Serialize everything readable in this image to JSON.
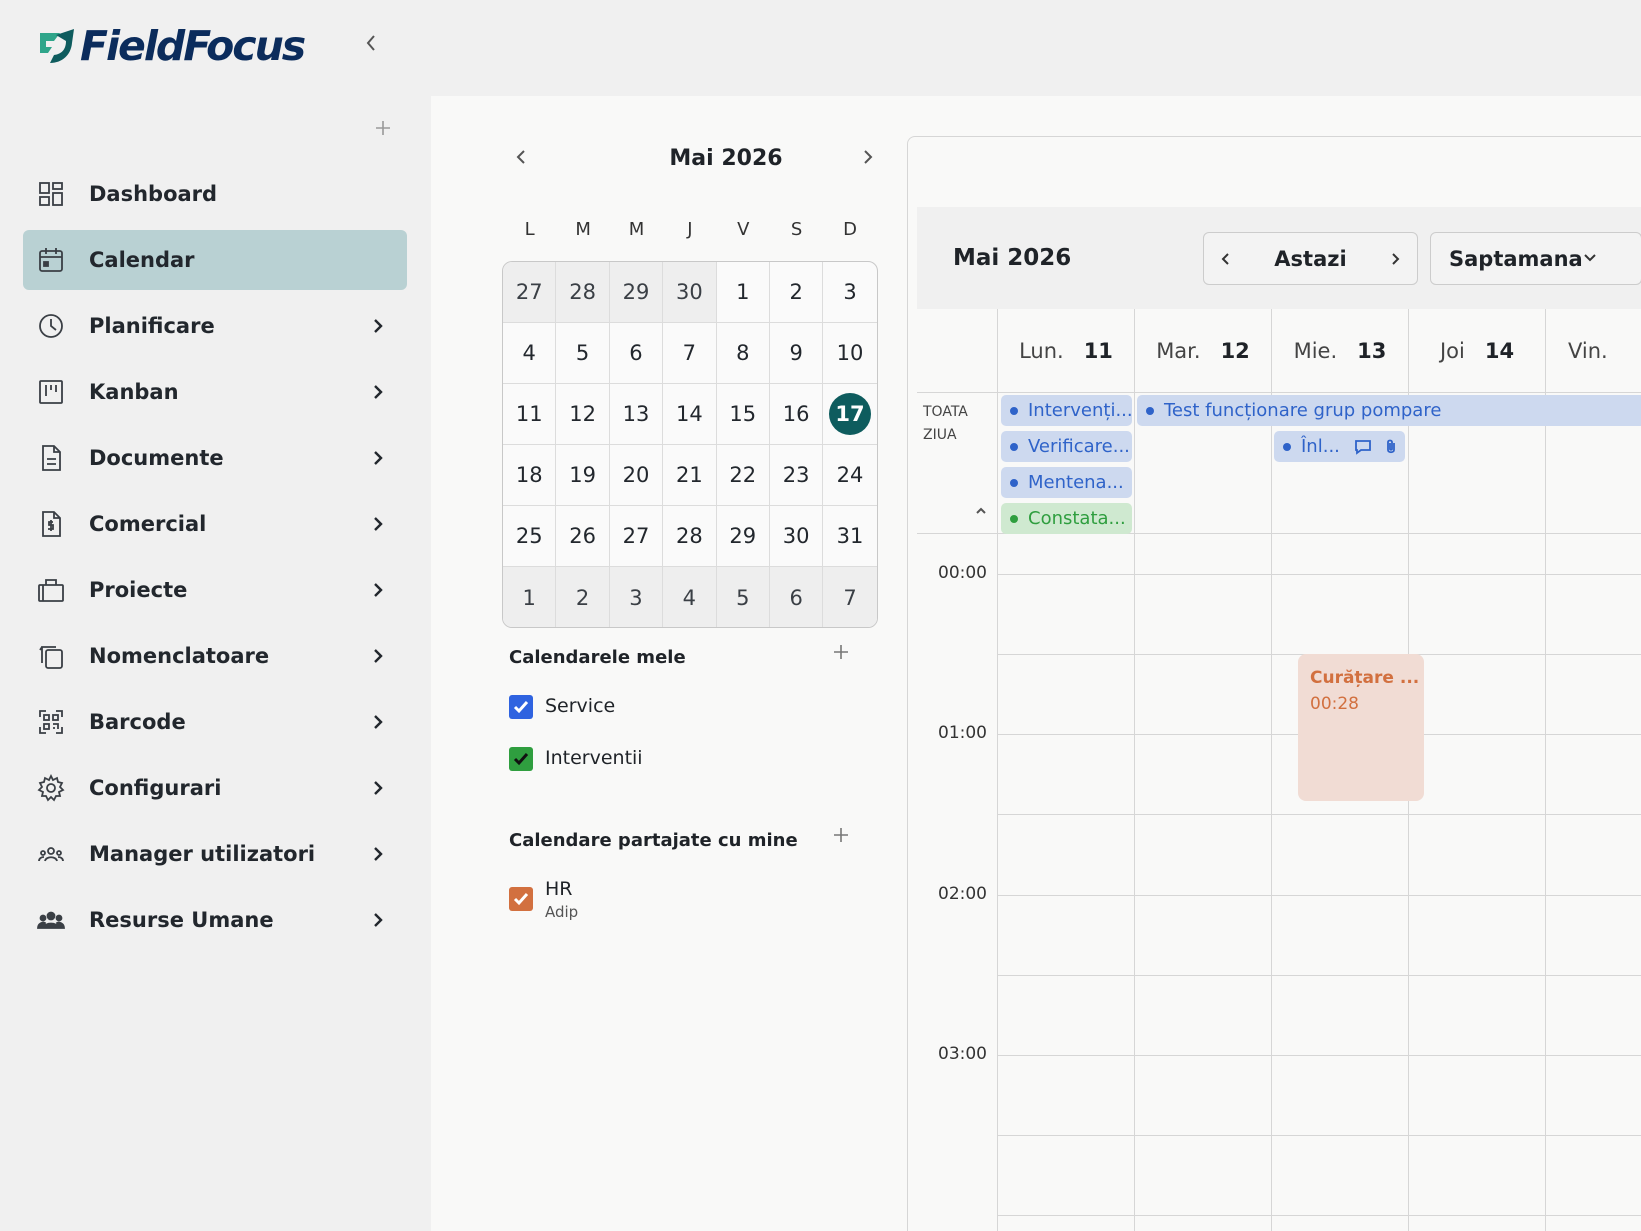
{
  "brand": {
    "name_part1": "Field",
    "name_part2": "Focus",
    "accent": "#0e5c5e",
    "logo_color": "#0b2c5c"
  },
  "sidebar": {
    "collapse_icon": "chevron-left-icon",
    "add_icon": "plus-icon",
    "items": [
      {
        "label": "Dashboard",
        "icon": "dashboard-icon",
        "active": false,
        "has_submenu": false
      },
      {
        "label": "Calendar",
        "icon": "calendar-icon",
        "active": true,
        "has_submenu": false
      },
      {
        "label": "Planificare",
        "icon": "clock-icon",
        "active": false,
        "has_submenu": true
      },
      {
        "label": "Kanban",
        "icon": "kanban-icon",
        "active": false,
        "has_submenu": true
      },
      {
        "label": "Documente",
        "icon": "document-icon",
        "active": false,
        "has_submenu": true
      },
      {
        "label": "Comercial",
        "icon": "invoice-icon",
        "active": false,
        "has_submenu": true
      },
      {
        "label": "Proiecte",
        "icon": "briefcase-icon",
        "active": false,
        "has_submenu": true
      },
      {
        "label": "Nomenclatoare",
        "icon": "copy-icon",
        "active": false,
        "has_submenu": true
      },
      {
        "label": "Barcode",
        "icon": "qr-code-icon",
        "active": false,
        "has_submenu": true
      },
      {
        "label": "Configurari",
        "icon": "gear-icon",
        "active": false,
        "has_submenu": true
      },
      {
        "label": "Manager utilizatori",
        "icon": "users-icon",
        "active": false,
        "has_submenu": true
      },
      {
        "label": "Resurse Umane",
        "icon": "team-icon",
        "active": false,
        "has_submenu": true
      }
    ]
  },
  "mini_calendar": {
    "title": "Mai 2026",
    "weekdays": [
      "L",
      "M",
      "M",
      "J",
      "V",
      "S",
      "D"
    ],
    "today": "17",
    "weeks": [
      [
        {
          "d": "27",
          "o": true
        },
        {
          "d": "28",
          "o": true
        },
        {
          "d": "29",
          "o": true
        },
        {
          "d": "30",
          "o": true
        },
        {
          "d": "1"
        },
        {
          "d": "2"
        },
        {
          "d": "3"
        }
      ],
      [
        {
          "d": "4"
        },
        {
          "d": "5"
        },
        {
          "d": "6"
        },
        {
          "d": "7"
        },
        {
          "d": "8"
        },
        {
          "d": "9"
        },
        {
          "d": "10"
        }
      ],
      [
        {
          "d": "11"
        },
        {
          "d": "12"
        },
        {
          "d": "13"
        },
        {
          "d": "14"
        },
        {
          "d": "15"
        },
        {
          "d": "16"
        },
        {
          "d": "17",
          "today": true
        }
      ],
      [
        {
          "d": "18"
        },
        {
          "d": "19"
        },
        {
          "d": "20"
        },
        {
          "d": "21"
        },
        {
          "d": "22"
        },
        {
          "d": "23"
        },
        {
          "d": "24"
        }
      ],
      [
        {
          "d": "25"
        },
        {
          "d": "26"
        },
        {
          "d": "27"
        },
        {
          "d": "28"
        },
        {
          "d": "29"
        },
        {
          "d": "30"
        },
        {
          "d": "31"
        }
      ],
      [
        {
          "d": "1",
          "o": true
        },
        {
          "d": "2",
          "o": true
        },
        {
          "d": "3",
          "o": true
        },
        {
          "d": "4",
          "o": true
        },
        {
          "d": "5",
          "o": true
        },
        {
          "d": "6",
          "o": true
        },
        {
          "d": "7",
          "o": true
        }
      ]
    ]
  },
  "my_calendars": {
    "title": "Calendarele mele",
    "items": [
      {
        "name": "Service",
        "checked": true,
        "color": "#2f63e0"
      },
      {
        "name": "Interventii",
        "checked": true,
        "color": "#2f9e3f"
      }
    ]
  },
  "shared_calendars": {
    "title": "Calendare partajate cu mine",
    "items": [
      {
        "name": "HR",
        "owner": "Adip",
        "checked": true,
        "color": "#d2703f"
      }
    ]
  },
  "week_view": {
    "title": "Mai 2026",
    "today_label": "Astazi",
    "view_mode": "Saptamana",
    "days": [
      {
        "name": "Lun.",
        "date": "11"
      },
      {
        "name": "Mar.",
        "date": "12"
      },
      {
        "name": "Mie.",
        "date": "13"
      },
      {
        "name": "Joi",
        "date": "14"
      },
      {
        "name": "Vin.",
        "date": ""
      }
    ],
    "all_day_label_1": "TOATA",
    "all_day_label_2": "ZIUA",
    "all_day_events": [
      {
        "title": "Intervenți...",
        "color": "blue"
      },
      {
        "title": "Verificare...",
        "color": "blue"
      },
      {
        "title": "Mentena...",
        "color": "blue"
      },
      {
        "title": "Constata...",
        "color": "green"
      },
      {
        "title": "Test funcționare grup pompare",
        "color": "blue"
      },
      {
        "title": "Înl...",
        "color": "blue",
        "icons": [
          "comment-icon",
          "paperclip-icon"
        ]
      }
    ],
    "hours": [
      "00:00",
      "01:00",
      "02:00",
      "03:00"
    ],
    "timed_events": [
      {
        "title": "Curățare ...",
        "time": "00:28",
        "color": "#d2703f"
      }
    ]
  }
}
